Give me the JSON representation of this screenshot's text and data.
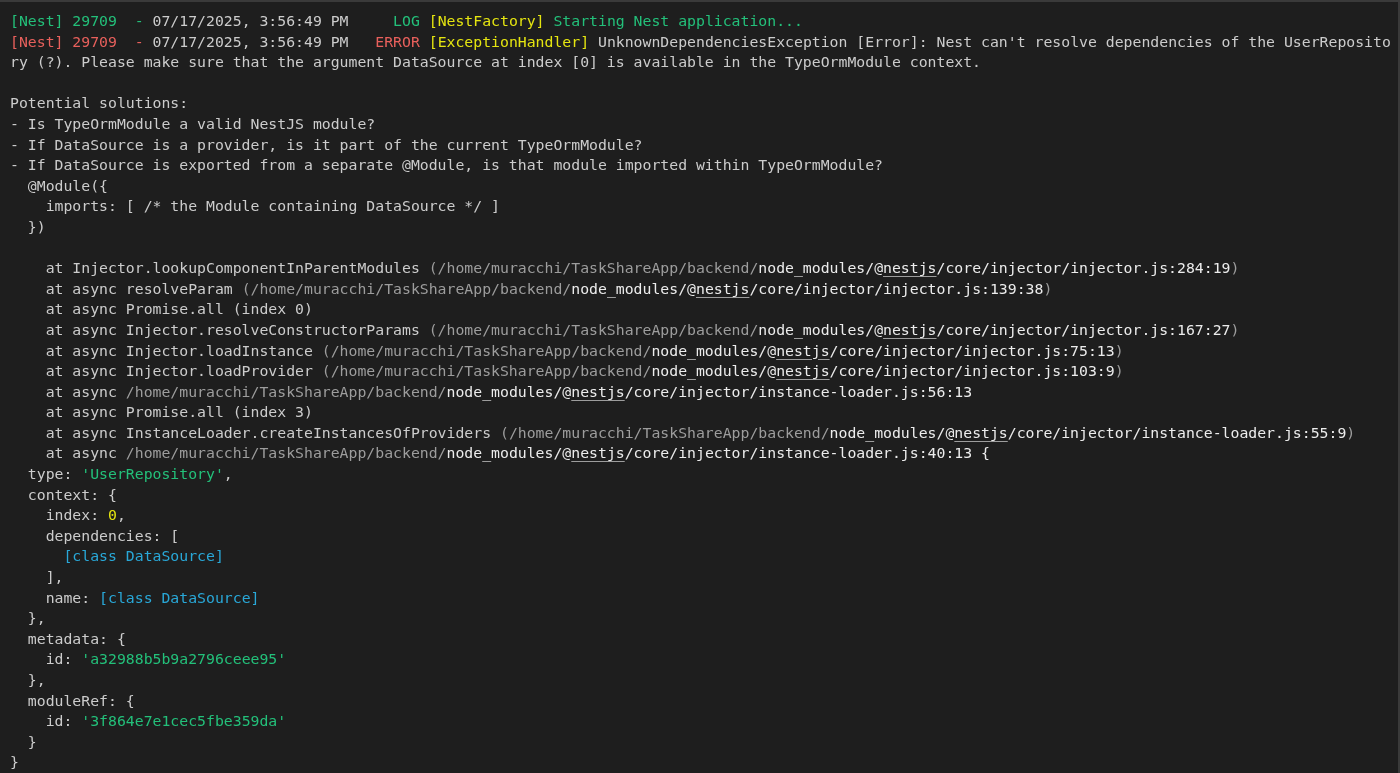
{
  "terminal": {
    "blocks": [
      {
        "lines": [
          {
            "segments": [
              {
                "kind": "green",
                "text": "[Nest] 29709  - "
              },
              {
                "kind": "plain",
                "text": "07/17/2025, 3:56:49 PM     "
              },
              {
                "kind": "green",
                "text": "LOG "
              },
              {
                "kind": "yellow",
                "text": "[NestFactory] "
              },
              {
                "kind": "green",
                "text": "Starting Nest application..."
              }
            ]
          },
          {
            "segments": [
              {
                "kind": "red",
                "text": "[Nest] 29709  - "
              },
              {
                "kind": "plain",
                "text": "07/17/2025, 3:56:49 PM   "
              },
              {
                "kind": "red",
                "text": "ERROR "
              },
              {
                "kind": "yellow",
                "text": "[ExceptionHandler] "
              },
              {
                "kind": "plain",
                "text": "UnknownDependenciesException [Error]: Nest can't resolve dependencies of the UserReposito"
              }
            ]
          },
          {
            "segments": [
              {
                "kind": "plain",
                "text": "ry (?). Please make sure that the argument DataSource at index [0] is available in the TypeOrmModule context."
              }
            ]
          }
        ]
      },
      {
        "lines": [
          {
            "segments": [
              {
                "kind": "plain",
                "text": "Potential solutions:"
              }
            ]
          },
          {
            "segments": [
              {
                "kind": "plain",
                "text": "- Is TypeOrmModule a valid NestJS module?"
              }
            ]
          },
          {
            "segments": [
              {
                "kind": "plain",
                "text": "- If DataSource is a provider, is it part of the current TypeOrmModule?"
              }
            ]
          },
          {
            "segments": [
              {
                "kind": "plain",
                "text": "- If DataSource is exported from a separate @Module, is that module imported within TypeOrmModule?"
              }
            ]
          },
          {
            "segments": [
              {
                "kind": "plain",
                "text": "  @Module({"
              }
            ]
          },
          {
            "segments": [
              {
                "kind": "plain",
                "text": "    imports: [ /* the Module containing DataSource */ ]"
              }
            ]
          },
          {
            "segments": [
              {
                "kind": "plain",
                "text": "  })"
              }
            ]
          }
        ]
      },
      {
        "lines": [
          {
            "segments": [
              {
                "kind": "plain",
                "text": "    at Injector.lookupComponentInParentModules "
              },
              {
                "kind": "dim",
                "text": "(/home/muracchi/TaskShareApp/backend/"
              },
              {
                "kind": "bright",
                "text": "node_modules/@"
              },
              {
                "kind": "link",
                "text": "nestjs"
              },
              {
                "kind": "bright",
                "text": "/core/injector/injector.js:284:19"
              },
              {
                "kind": "dim",
                "text": ")"
              }
            ]
          },
          {
            "segments": [
              {
                "kind": "plain",
                "text": "    at async resolveParam "
              },
              {
                "kind": "dim",
                "text": "(/home/muracchi/TaskShareApp/backend/"
              },
              {
                "kind": "bright",
                "text": "node_modules/@"
              },
              {
                "kind": "link",
                "text": "nestjs"
              },
              {
                "kind": "bright",
                "text": "/core/injector/injector.js:139:38"
              },
              {
                "kind": "dim",
                "text": ")"
              }
            ]
          },
          {
            "segments": [
              {
                "kind": "plain",
                "text": "    at async Promise.all (index 0)"
              }
            ]
          },
          {
            "segments": [
              {
                "kind": "plain",
                "text": "    at async Injector.resolveConstructorParams "
              },
              {
                "kind": "dim",
                "text": "(/home/muracchi/TaskShareApp/backend/"
              },
              {
                "kind": "bright",
                "text": "node_modules/@"
              },
              {
                "kind": "link",
                "text": "nestjs"
              },
              {
                "kind": "bright",
                "text": "/core/injector/injector.js:167:27"
              },
              {
                "kind": "dim",
                "text": ")"
              }
            ]
          },
          {
            "segments": [
              {
                "kind": "plain",
                "text": "    at async Injector.loadInstance "
              },
              {
                "kind": "dim",
                "text": "(/home/muracchi/TaskShareApp/backend/"
              },
              {
                "kind": "bright",
                "text": "node_modules/@"
              },
              {
                "kind": "link",
                "text": "nestjs"
              },
              {
                "kind": "bright",
                "text": "/core/injector/injector.js:75:13"
              },
              {
                "kind": "dim",
                "text": ")"
              }
            ]
          },
          {
            "segments": [
              {
                "kind": "plain",
                "text": "    at async Injector.loadProvider "
              },
              {
                "kind": "dim",
                "text": "(/home/muracchi/TaskShareApp/backend/"
              },
              {
                "kind": "bright",
                "text": "node_modules/@"
              },
              {
                "kind": "link",
                "text": "nestjs"
              },
              {
                "kind": "bright",
                "text": "/core/injector/injector.js:103:9"
              },
              {
                "kind": "dim",
                "text": ")"
              }
            ]
          },
          {
            "segments": [
              {
                "kind": "plain",
                "text": "    at async "
              },
              {
                "kind": "dim",
                "text": "/home/muracchi/TaskShareApp/backend/"
              },
              {
                "kind": "bright",
                "text": "node_modules/@"
              },
              {
                "kind": "link",
                "text": "nestjs"
              },
              {
                "kind": "bright",
                "text": "/core/injector/instance-loader.js:56:13"
              }
            ]
          },
          {
            "segments": [
              {
                "kind": "plain",
                "text": "    at async Promise.all (index 3)"
              }
            ]
          },
          {
            "segments": [
              {
                "kind": "plain",
                "text": "    at async InstanceLoader.createInstancesOfProviders "
              },
              {
                "kind": "dim",
                "text": "(/home/muracchi/TaskShareApp/backend/"
              },
              {
                "kind": "bright",
                "text": "node_modules/@"
              },
              {
                "kind": "link",
                "text": "nestjs"
              },
              {
                "kind": "bright",
                "text": "/core/injector/instance-loader.js:55:9"
              },
              {
                "kind": "dim",
                "text": ")"
              }
            ]
          },
          {
            "segments": [
              {
                "kind": "plain",
                "text": "    at async "
              },
              {
                "kind": "dim",
                "text": "/home/muracchi/TaskShareApp/backend/"
              },
              {
                "kind": "bright",
                "text": "node_modules/@"
              },
              {
                "kind": "link",
                "text": "nestjs"
              },
              {
                "kind": "bright",
                "text": "/core/injector/instance-loader.js:40:13 {"
              }
            ]
          },
          {
            "segments": [
              {
                "kind": "plain",
                "text": "  type: "
              },
              {
                "kind": "green",
                "text": "'UserRepository'"
              },
              {
                "kind": "plain",
                "text": ","
              }
            ]
          },
          {
            "segments": [
              {
                "kind": "plain",
                "text": "  context: {"
              }
            ]
          },
          {
            "segments": [
              {
                "kind": "plain",
                "text": "    index: "
              },
              {
                "kind": "yellow",
                "text": "0"
              },
              {
                "kind": "plain",
                "text": ","
              }
            ]
          },
          {
            "segments": [
              {
                "kind": "plain",
                "text": "    dependencies: ["
              }
            ]
          },
          {
            "segments": [
              {
                "kind": "cyan",
                "text": "      [class DataSource]"
              }
            ]
          },
          {
            "segments": [
              {
                "kind": "plain",
                "text": "    ],"
              }
            ]
          },
          {
            "segments": [
              {
                "kind": "plain",
                "text": "    name: "
              },
              {
                "kind": "cyan",
                "text": "[class DataSource]"
              }
            ]
          },
          {
            "segments": [
              {
                "kind": "plain",
                "text": "  },"
              }
            ]
          },
          {
            "segments": [
              {
                "kind": "plain",
                "text": "  metadata: {"
              }
            ]
          },
          {
            "segments": [
              {
                "kind": "plain",
                "text": "    id: "
              },
              {
                "kind": "green",
                "text": "'a32988b5b9a2796ceee95'"
              }
            ]
          },
          {
            "segments": [
              {
                "kind": "plain",
                "text": "  },"
              }
            ]
          },
          {
            "segments": [
              {
                "kind": "plain",
                "text": "  moduleRef: {"
              }
            ]
          },
          {
            "segments": [
              {
                "kind": "plain",
                "text": "    id: "
              },
              {
                "kind": "green",
                "text": "'3f864e7e1cec5fbe359da'"
              }
            ]
          },
          {
            "segments": [
              {
                "kind": "plain",
                "text": "  }"
              }
            ]
          },
          {
            "segments": [
              {
                "kind": "plain",
                "text": "}"
              }
            ]
          }
        ]
      }
    ]
  }
}
